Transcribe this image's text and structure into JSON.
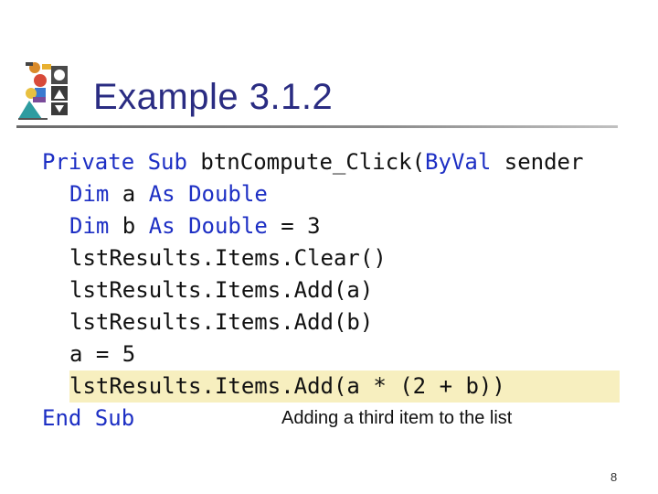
{
  "slide": {
    "title": "Example 3.1.2",
    "caption": "Adding a third item to the list",
    "page_number": "8",
    "code": {
      "line1": {
        "kw1": "Private Sub",
        "text1": " btnCompute_Click(",
        "kw2": "ByVal",
        "text2": " sender"
      },
      "line2": {
        "kw1": "Dim",
        "text1": " a ",
        "kw2": "As Double"
      },
      "line3": {
        "kw1": "Dim",
        "text1": " b ",
        "kw2": "As Double",
        "text2": " = 3"
      },
      "line4": {
        "text": "lstResults.Items.Clear()"
      },
      "line5": {
        "text": "lstResults.Items.Add(a)"
      },
      "line6": {
        "text": "lstResults.Items.Add(b)"
      },
      "line7": {
        "text": "a = 5"
      },
      "line8": {
        "text": "lstResults.Items.Add(a * (2 + b))"
      },
      "line9": {
        "kw1": "End Sub"
      }
    },
    "colors": {
      "title": "#2a2c82",
      "keyword": "#1d2fc4",
      "highlight": "#f7efbf"
    }
  }
}
